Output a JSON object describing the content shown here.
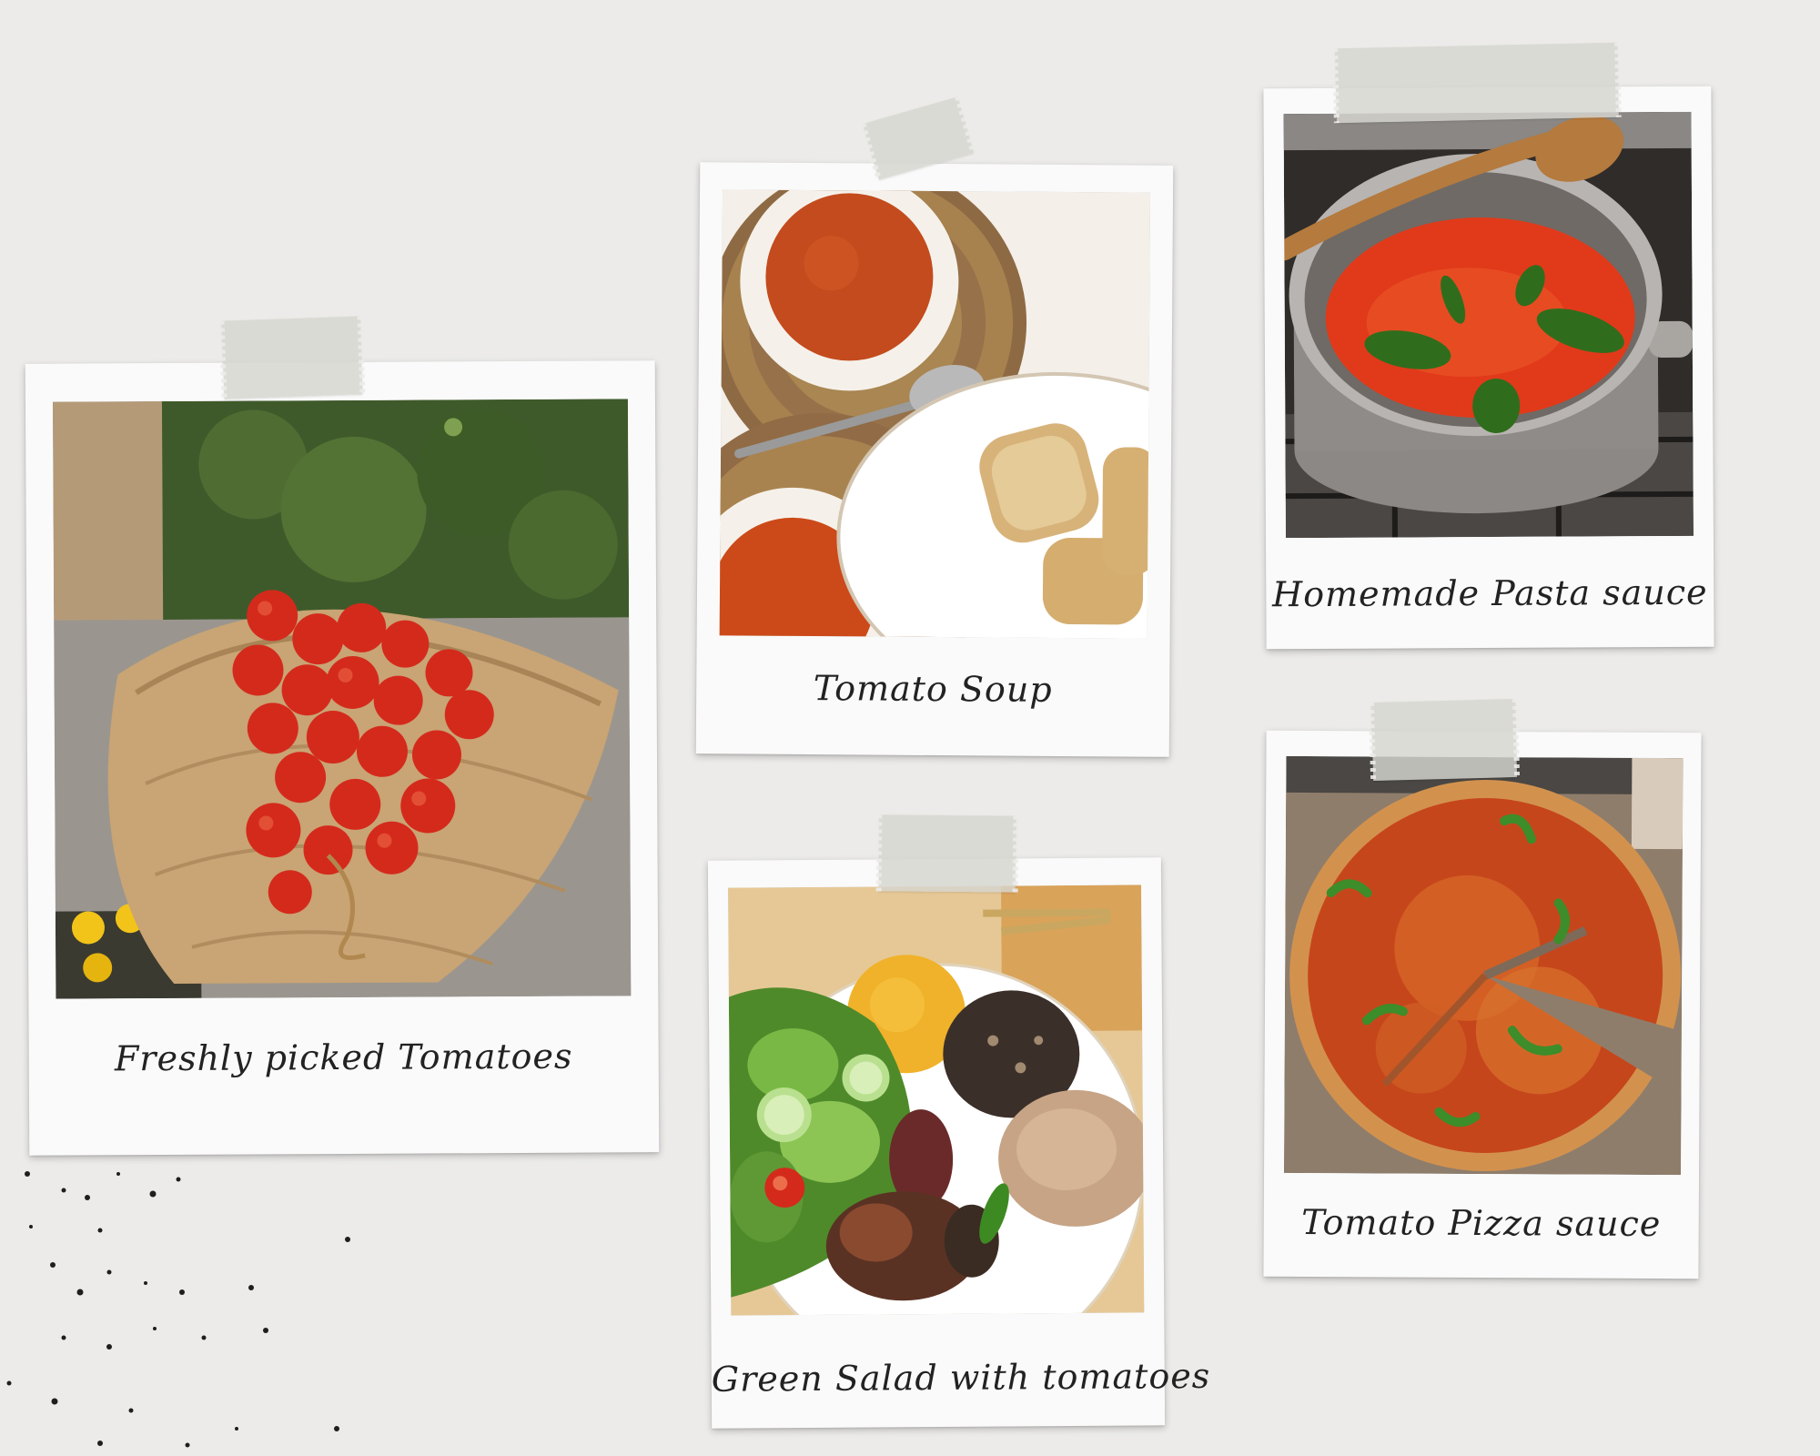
{
  "board": {
    "background": "#ecebe9",
    "polaroids": [
      {
        "caption": "Freshly picked Tomatoes",
        "photo": "tomato-basket-photo"
      },
      {
        "caption": "Tomato Soup",
        "photo": "tomato-soup-photo"
      },
      {
        "caption": "Homemade Pasta sauce",
        "photo": "pasta-sauce-photo"
      },
      {
        "caption": "Green Salad with tomatoes",
        "photo": "green-salad-photo"
      },
      {
        "caption": "Tomato Pizza sauce",
        "photo": "pizza-photo"
      }
    ]
  },
  "colors": {
    "tomato": "#d42a1c",
    "basket": "#c9a474",
    "soup": "#c9501f",
    "sauce": "#e03a1a",
    "basil": "#2f6d1c",
    "tape": "#d6d6d0"
  }
}
